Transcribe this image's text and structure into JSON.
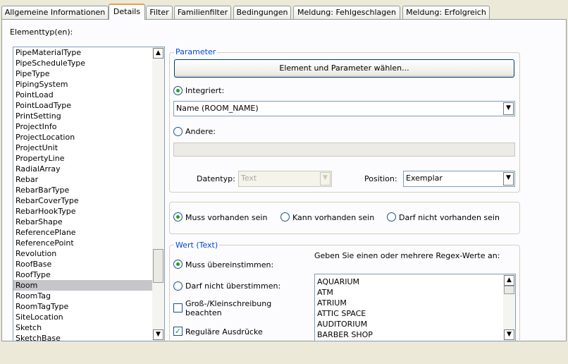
{
  "tabs": [
    {
      "label": "Allgemeine Informationen"
    },
    {
      "label": "Details"
    },
    {
      "label": "Filter"
    },
    {
      "label": "Familienfilter"
    },
    {
      "label": "Bedingungen"
    },
    {
      "label": "Meldung: Fehlgeschlagen"
    },
    {
      "label": "Meldung: Erfolgreich"
    }
  ],
  "element_types_label": "Elementtyp(en):",
  "element_types": [
    "PipeMaterialType",
    "PipeScheduleType",
    "PipeType",
    "PipingSystem",
    "PointLoad",
    "PointLoadType",
    "PrintSetting",
    "ProjectInfo",
    "ProjectLocation",
    "ProjectUnit",
    "PropertyLine",
    "RadialArray",
    "Rebar",
    "RebarBarType",
    "RebarCoverType",
    "RebarHookType",
    "RebarShape",
    "ReferencePlane",
    "ReferencePoint",
    "Revolution",
    "RoofBase",
    "RoofType",
    "Room",
    "RoomTag",
    "RoomTagType",
    "SiteLocation",
    "Sketch",
    "SketchBase"
  ],
  "selected_element_type": "Room",
  "parameter": {
    "legend": "Parameter",
    "choose_button": "Element und Parameter wählen...",
    "integrated_label": "Integriert:",
    "integrated_value": "Name (ROOM_NAME)",
    "other_label": "Andere:",
    "datatype_label": "Datentyp:",
    "datatype_value": "Text",
    "position_label": "Position:",
    "position_value": "Exemplar"
  },
  "existence": {
    "must": "Muss vorhanden sein",
    "can": "Kann vorhanden sein",
    "must_not": "Darf nicht vorhanden sein"
  },
  "value": {
    "legend": "Wert (Text)",
    "must_match": "Muss übereinstimmen:",
    "must_not_match": "Darf nicht überstimmen:",
    "case_sensitive_1": "Groß-/Kleinschreibung",
    "case_sensitive_2": "beachten",
    "regex_label": "Reguläre Ausdrücke",
    "regex_prompt": "Geben Sie einen oder mehrere Regex-Werte an:",
    "regex_values": [
      "AQUARIUM",
      "ATM",
      "ATRIUM",
      "ATTIC SPACE",
      "AUDITORIUM",
      "BARBER SHOP"
    ]
  },
  "colors": {
    "tab_active_accent": "#e5a23d",
    "legend": "#0046d5",
    "radio_dot": "#21a121"
  }
}
